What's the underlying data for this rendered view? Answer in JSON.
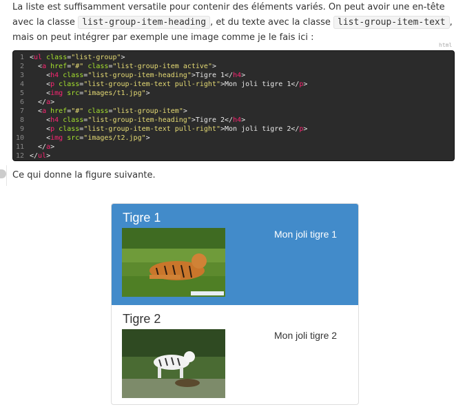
{
  "intro": {
    "part1": "La liste est suffisamment versatile pour contenir des éléments variés. On peut avoir une en-tête avec la classe ",
    "code1": "list-group-item-heading",
    "part2": ", et du texte avec la classe ",
    "code2": "list-group-item-text",
    "part3": ", mais on peut intégrer par exemple une image comme je le fais ici :"
  },
  "code_block": {
    "language": "html",
    "lines": [
      {
        "n": "1",
        "text": "<ul class=\"list-group\">"
      },
      {
        "n": "2",
        "text": "  <a href=\"#\" class=\"list-group-item active\">"
      },
      {
        "n": "3",
        "text": "    <h4 class=\"list-group-item-heading\">Tigre 1</h4>"
      },
      {
        "n": "4",
        "text": "    <p class=\"list-group-item-text pull-right\">Mon joli tigre 1</p>"
      },
      {
        "n": "5",
        "text": "    <img src=\"images/t1.jpg\">"
      },
      {
        "n": "6",
        "text": "  </a>"
      },
      {
        "n": "7",
        "text": "  <a href=\"#\" class=\"list-group-item\">"
      },
      {
        "n": "8",
        "text": "    <h4 class=\"list-group-item-heading\">Tigre 2</h4>"
      },
      {
        "n": "9",
        "text": "    <p class=\"list-group-item-text pull-right\">Mon joli tigre 2</p>"
      },
      {
        "n": "10",
        "text": "    <img src=\"images/t2.jpg\">"
      },
      {
        "n": "11",
        "text": "  </a>"
      },
      {
        "n": "12",
        "text": "</ul>"
      }
    ]
  },
  "caption": "Ce qui donne la figure suivante.",
  "list_group": {
    "items": [
      {
        "heading": "Tigre 1",
        "text": "Mon joli tigre 1",
        "active": true
      },
      {
        "heading": "Tigre 2",
        "text": "Mon joli tigre 2",
        "active": false
      }
    ]
  },
  "colors": {
    "active_bg": "#428bca",
    "code_bg": "#2b2b2b",
    "tag": "#f92672",
    "attr": "#a6e22e",
    "string": "#e6db74"
  }
}
